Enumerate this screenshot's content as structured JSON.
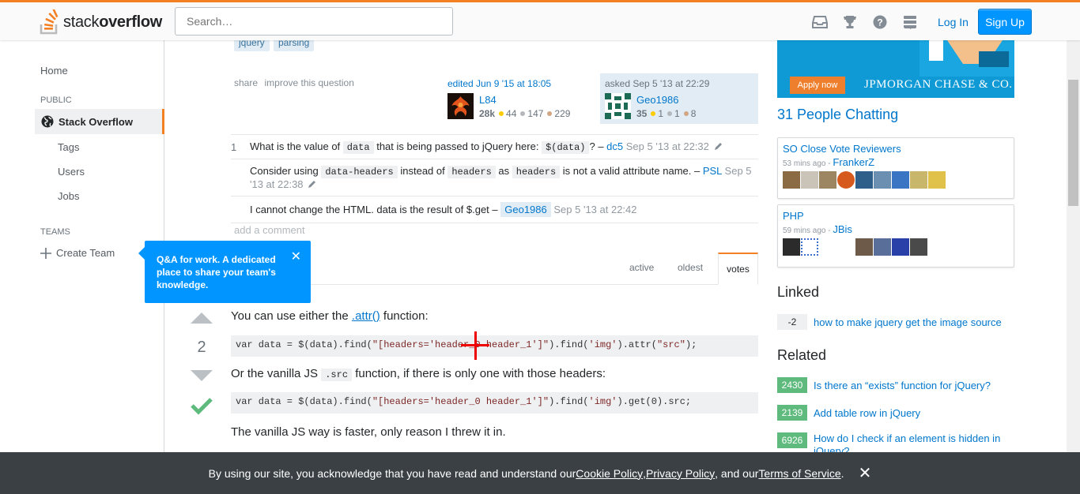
{
  "header": {
    "logo_light": "stack",
    "logo_bold": "overflow",
    "search_placeholder": "Search…",
    "login": "Log In",
    "signup": "Sign Up",
    "icons": [
      "inbox-icon",
      "trophy-icon",
      "help-icon",
      "stack-exchange-icon"
    ]
  },
  "sidebar": {
    "home": "Home",
    "public": "PUBLIC",
    "stackoverflow": "Stack Overflow",
    "tags": "Tags",
    "users": "Users",
    "jobs": "Jobs",
    "teams": "TEAMS",
    "create_team": "Create Team"
  },
  "popup": {
    "text": "Q&A for work. A dedicated place to share your team's knowledge."
  },
  "question": {
    "tags": [
      "jquery",
      "parsing"
    ],
    "share": "share",
    "improve": "improve this question",
    "edited": {
      "label": "edited Jun 9 '15 at 18:05",
      "user": "L84",
      "rep": "28k",
      "gold": "44",
      "silver": "147",
      "bronze": "229"
    },
    "asked": {
      "label": "asked Sep 5 '13 at 22:29",
      "user": "Geo1986",
      "rep": "35",
      "gold": "1",
      "silver": "1",
      "bronze": "8"
    }
  },
  "comments": [
    {
      "score": "1",
      "t1": "What is the value of ",
      "c1": "data",
      "t2": " that is being passed to jQuery here: ",
      "c2": "$(data)",
      "t3": "? – ",
      "user": "dc5",
      "date": "Sep 5 '13 at 22:32"
    },
    {
      "t1": "Consider using ",
      "c1": "data-headers",
      "t2": " instead of ",
      "c2": "headers",
      "t3": " as ",
      "c3": "headers",
      "t4": " is not a valid attribute name. – ",
      "user": "PSL",
      "date": "Sep 5 '13 at 22:38"
    },
    {
      "t1": "I cannot change the HTML. data is the result of $.get – ",
      "user": "Geo1986",
      "date": "Sep 5 '13 at 22:42"
    }
  ],
  "add_comment": "add a comment",
  "answer_tabs": {
    "active": "active",
    "oldest": "oldest",
    "votes": "votes"
  },
  "answer": {
    "votes": "2",
    "p1_before": "You can use either the ",
    "p1_link": ".attr()",
    "p1_after": " function:",
    "code1_a": "var data = $(data).find(",
    "code1_str": "\"[headers='header_0 header_1']\"",
    "code1_b": ").find(",
    "code1_str2": "'img'",
    "code1_c": ").attr(",
    "code1_str3": "\"src\"",
    "code1_d": ");",
    "p2_before": "Or the vanilla JS ",
    "p2_code": ".src",
    "p2_after": " function, if there is only one with those headers:",
    "code2_a": "var data = $(data).find(",
    "code2_str": "\"[headers='header_0 header_1']\"",
    "code2_b": ").find(",
    "code2_str2": "'img'",
    "code2_c": ").get(0).src;",
    "p3": "The vanilla JS way is faster, only reason I threw it in."
  },
  "ad": {
    "apply": "Apply now",
    "brand": "JPMORGAN CHASE & CO."
  },
  "chat": {
    "heading": "31 People Chatting",
    "rooms": [
      {
        "name": "SO Close Vote Reviewers",
        "ago": "53 mins ago - ",
        "user": "FrankerZ"
      },
      {
        "name": "PHP",
        "ago": "59 mins ago - ",
        "user": "JBis"
      }
    ]
  },
  "linked": {
    "heading": "Linked",
    "items": [
      {
        "score": "-2",
        "title": "how to make jquery get the image source"
      }
    ]
  },
  "related": {
    "heading": "Related",
    "items": [
      {
        "score": "2430",
        "title": "Is there an “exists” function for jQuery?"
      },
      {
        "score": "2139",
        "title": "Add table row in jQuery"
      },
      {
        "score": "6926",
        "title": "How do I check if an element is hidden in jQuery?"
      }
    ]
  },
  "cookie": {
    "text1": "By using our site, you acknowledge that you have read and understand our ",
    "cookie_policy": "Cookie Policy",
    "sep1": ", ",
    "privacy_policy": "Privacy Policy",
    "text2": ", and our ",
    "terms": "Terms of Service",
    "text3": "."
  },
  "colors": {
    "accent": "#f48024",
    "link": "#0077cc",
    "primary_button": "#0095ff",
    "accepted": "#5fba7d"
  }
}
